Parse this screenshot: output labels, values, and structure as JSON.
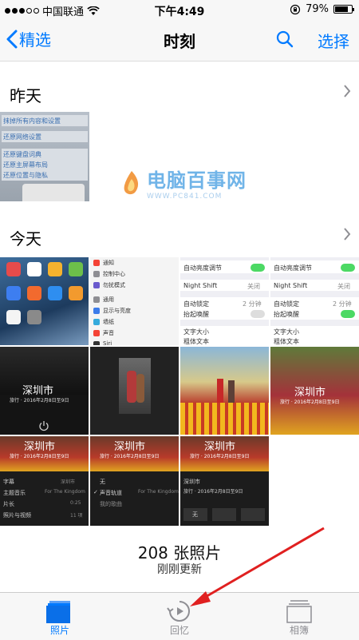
{
  "status": {
    "carrier": "中国联通",
    "time": "下午4:49",
    "battery": "79%",
    "battery_level": 0.79
  },
  "nav": {
    "back_label": "精选",
    "title": "时刻",
    "select_label": "选择"
  },
  "sections": [
    {
      "title": "昨天"
    },
    {
      "title": "今天"
    }
  ],
  "watermark": {
    "text": "电脑百事网",
    "sub": "WWW.PC841.COM"
  },
  "yesterday_thumb": {
    "rows": [
      "抹掉所有内容和设置",
      "还原网络设置",
      "还原键盘词典",
      "还原主屏幕布局",
      "还原位置与隐私"
    ]
  },
  "settings_thumb": {
    "rows": [
      "通知",
      "控制中心",
      "勿扰模式",
      "通用",
      "显示与亮度",
      "墙纸",
      "声音",
      "Siri"
    ]
  },
  "display_thumb": {
    "rows": [
      "自动亮度调节",
      "Night Shift",
      "自动锁定",
      "抬起唤醒",
      "文字大小",
      "粗体文本"
    ],
    "values": [
      "关闭",
      "2 分钟"
    ]
  },
  "memory_cards": {
    "title": "深圳市",
    "subtitle": "旅行 · 2016年2月8日至9日"
  },
  "memory_settings": {
    "rows": [
      "字幕",
      "主题音乐",
      "片长",
      "照片与视频"
    ],
    "values": [
      "深圳市",
      "For The Kingdom",
      "0:25",
      "11 项"
    ]
  },
  "music_list": {
    "rows": [
      "无",
      "声音轨道",
      "我的歌曲"
    ],
    "value": "For The Kingdom"
  },
  "footer": {
    "count": "208 张照片",
    "updated": "刚刚更新"
  },
  "tabs": [
    {
      "label": "照片",
      "active": true
    },
    {
      "label": "回忆",
      "active": false
    },
    {
      "label": "相簿",
      "active": false
    }
  ],
  "colors": {
    "accent": "#007aff",
    "arrow": "#e02020"
  }
}
